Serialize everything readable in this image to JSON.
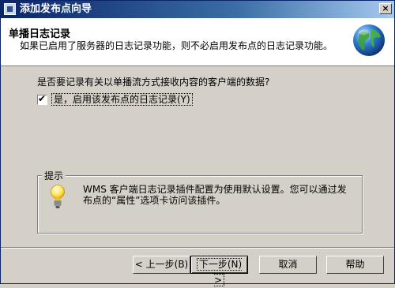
{
  "window": {
    "title": "添加发布点向导",
    "close_glyph": "×"
  },
  "header": {
    "title": "单播日志记录",
    "description": "如果已启用了服务器的日志记录功能，则不必启用发布点的日志记录功能。",
    "icon": "globe-icon"
  },
  "body": {
    "question": "是否要记录有关以单播流方式接收内容的客户端的数据?",
    "checkbox": {
      "label": "是，启用该发布点的日志记录(Y)",
      "checked": true
    }
  },
  "tip": {
    "title": "提示",
    "text": "WMS 客户端日志记录插件配置为使用默认设置。您可以通过发布点的“属性”选项卡访问该插件。",
    "icon": "lightbulb-icon"
  },
  "buttons": {
    "back": "< 上一步(B)",
    "next": "下一步(N) >",
    "cancel": "取消",
    "help": "帮助"
  }
}
